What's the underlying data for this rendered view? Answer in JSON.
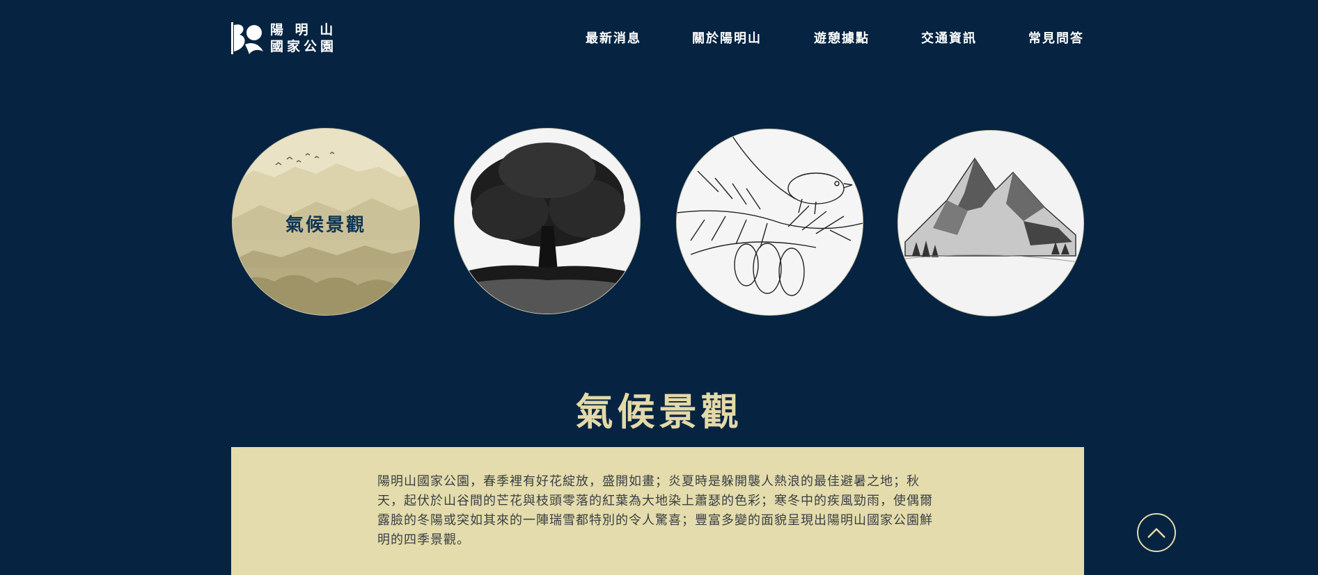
{
  "brand": {
    "line1": "陽 明 山",
    "line2": "國家公園"
  },
  "nav": {
    "items": [
      {
        "label": "最新消息"
      },
      {
        "label": "關於陽明山"
      },
      {
        "label": "遊憩據點"
      },
      {
        "label": "交通資訊"
      },
      {
        "label": "常見問答"
      }
    ]
  },
  "cards": [
    {
      "label": "氣候景觀",
      "icon": "misty-mountains-illustration"
    },
    {
      "icon": "tree-illustration"
    },
    {
      "icon": "bird-on-pine-illustration"
    },
    {
      "icon": "mountain-illustration"
    }
  ],
  "section": {
    "title": "氣候景觀",
    "body": "陽明山國家公園，春季裡有好花綻放，盛開如畫；炎夏時是躲開襲人熱浪的最佳避暑之地；秋天，起伏於山谷間的芒花與枝頭零落的紅葉為大地染上蕭瑟的色彩；寒冬中的疾風勁雨，使偶爾露臉的冬陽或突如其來的一陣瑞雪都特別的令人驚喜；豐富多變的面貌呈現出陽明山國家公園鮮明的四季景觀。"
  },
  "colors": {
    "background": "#062441",
    "accent": "#e4d9a8",
    "panel": "#e4dcac"
  }
}
